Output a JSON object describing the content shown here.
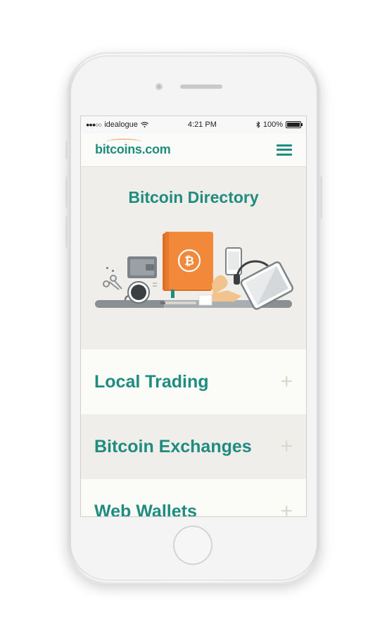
{
  "status_bar": {
    "carrier": "idealogue",
    "time": "4:21 PM",
    "battery": "100%"
  },
  "nav": {
    "logo_text": "bitcoins.com",
    "accent_color": "#1f8c7f",
    "logo_arc_color": "#f0953f"
  },
  "hero": {
    "title": "Bitcoin Directory"
  },
  "sections": [
    {
      "label": "Local Trading",
      "toggle": "+"
    },
    {
      "label": "Bitcoin Exchanges",
      "toggle": "+"
    },
    {
      "label": "Web Wallets",
      "toggle": "+"
    }
  ],
  "icons": {
    "signal": "signal-dots-icon",
    "wifi": "wifi-icon",
    "bluetooth": "bluetooth-icon",
    "battery": "battery-icon",
    "menu": "hamburger-menu-icon",
    "expand": "plus-icon",
    "bitcoin": "bitcoin-icon"
  }
}
